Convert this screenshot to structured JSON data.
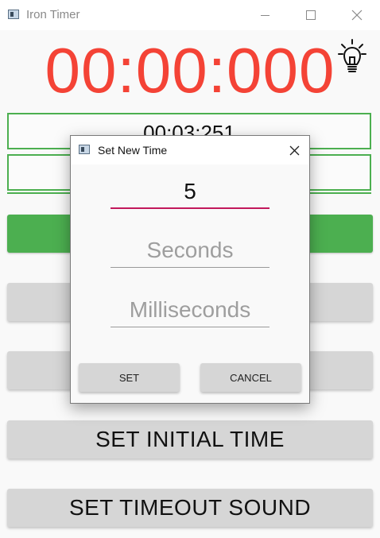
{
  "window": {
    "title": "Iron Timer",
    "minimize_icon": "minimize-icon",
    "maximize_icon": "maximize-icon",
    "close_icon": "close-icon"
  },
  "timer": {
    "display": "00:00:000",
    "color": "#f44336",
    "bulb_icon": "lightbulb-icon"
  },
  "fields": {
    "time_value": "00:03:251",
    "second_value": ""
  },
  "buttons": {
    "green_button_label": "",
    "gray_button_1_label": "",
    "gray_button_2_label": "",
    "set_initial_time": "SET INITIAL TIME",
    "set_timeout_sound": "SET TIMEOUT SOUND"
  },
  "dialog": {
    "title": "Set New Time",
    "close_icon": "close-icon",
    "minutes_value": "5",
    "seconds_placeholder": "Seconds",
    "milliseconds_placeholder": "Milliseconds",
    "set_label": "SET",
    "cancel_label": "CANCEL",
    "accent": "#c2185b"
  },
  "colors": {
    "green": "#4caf50",
    "button_gray": "#d6d6d6"
  }
}
